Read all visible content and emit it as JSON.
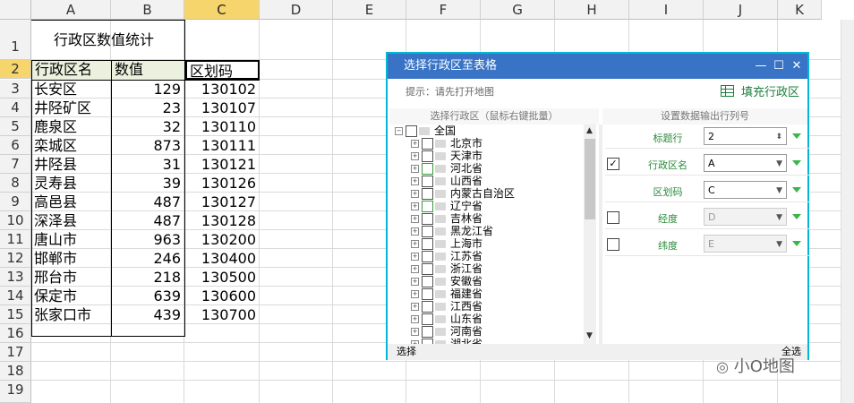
{
  "spreadsheet": {
    "columns": [
      "A",
      "B",
      "C",
      "D",
      "E",
      "F",
      "G",
      "H",
      "I",
      "J",
      "K"
    ],
    "rows": [
      "1",
      "2",
      "3",
      "4",
      "5",
      "6",
      "7",
      "8",
      "9",
      "10",
      "11",
      "12",
      "13",
      "14",
      "15",
      "16",
      "17",
      "18",
      "19"
    ],
    "title": "行政区数值统计",
    "headers": {
      "name": "行政区名",
      "value": "数值",
      "code": "区划码"
    },
    "data": [
      {
        "name": "长安区",
        "value": "129",
        "code": "130102"
      },
      {
        "name": "井陉矿区",
        "value": "23",
        "code": "130107"
      },
      {
        "name": "鹿泉区",
        "value": "32",
        "code": "130110"
      },
      {
        "name": "栾城区",
        "value": "873",
        "code": "130111"
      },
      {
        "name": "井陉县",
        "value": "31",
        "code": "130121"
      },
      {
        "name": "灵寿县",
        "value": "39",
        "code": "130126"
      },
      {
        "name": "高邑县",
        "value": "487",
        "code": "130127"
      },
      {
        "name": "深泽县",
        "value": "487",
        "code": "130128"
      },
      {
        "name": "唐山市",
        "value": "963",
        "code": "130200"
      },
      {
        "name": "邯郸市",
        "value": "246",
        "code": "130400"
      },
      {
        "name": "邢台市",
        "value": "218",
        "code": "130500"
      },
      {
        "name": "保定市",
        "value": "639",
        "code": "130600"
      },
      {
        "name": "张家口市",
        "value": "439",
        "code": "130700"
      }
    ]
  },
  "dialog": {
    "title": "选择行政区至表格",
    "tip": "提示：请先打开地图",
    "fill_button": "填充行政区",
    "left_header": "选择行政区（鼠标右键批量）",
    "right_header": "设置数据输出行列号",
    "tree_root": "全国",
    "tree_items": [
      "北京市",
      "天津市",
      "河北省",
      "山西省",
      "内蒙古自治区",
      "辽宁省",
      "吉林省",
      "黑龙江省",
      "上海市",
      "江苏省",
      "浙江省",
      "安徽省",
      "福建省",
      "江西省",
      "山东省",
      "河南省",
      "湖北省"
    ],
    "partial_items": [
      "河北省",
      "辽宁省"
    ],
    "fields": [
      {
        "label": "标题行",
        "value": "2",
        "checked": "",
        "has_check": false,
        "disabled": false
      },
      {
        "label": "行政区名",
        "value": "A",
        "checked": "✓",
        "has_check": true,
        "disabled": false
      },
      {
        "label": "区划码",
        "value": "C",
        "checked": "",
        "has_check": false,
        "disabled": false
      },
      {
        "label": "经度",
        "value": "D",
        "checked": "",
        "has_check": true,
        "disabled": true
      },
      {
        "label": "纬度",
        "value": "E",
        "checked": "",
        "has_check": true,
        "disabled": true
      }
    ],
    "status_left": "选择",
    "status_right": "全选",
    "colors": {
      "title_bar": "#3873c6",
      "border": "#00b8d4",
      "accent_green": "#3ab54a"
    }
  },
  "watermark": "小O地图"
}
